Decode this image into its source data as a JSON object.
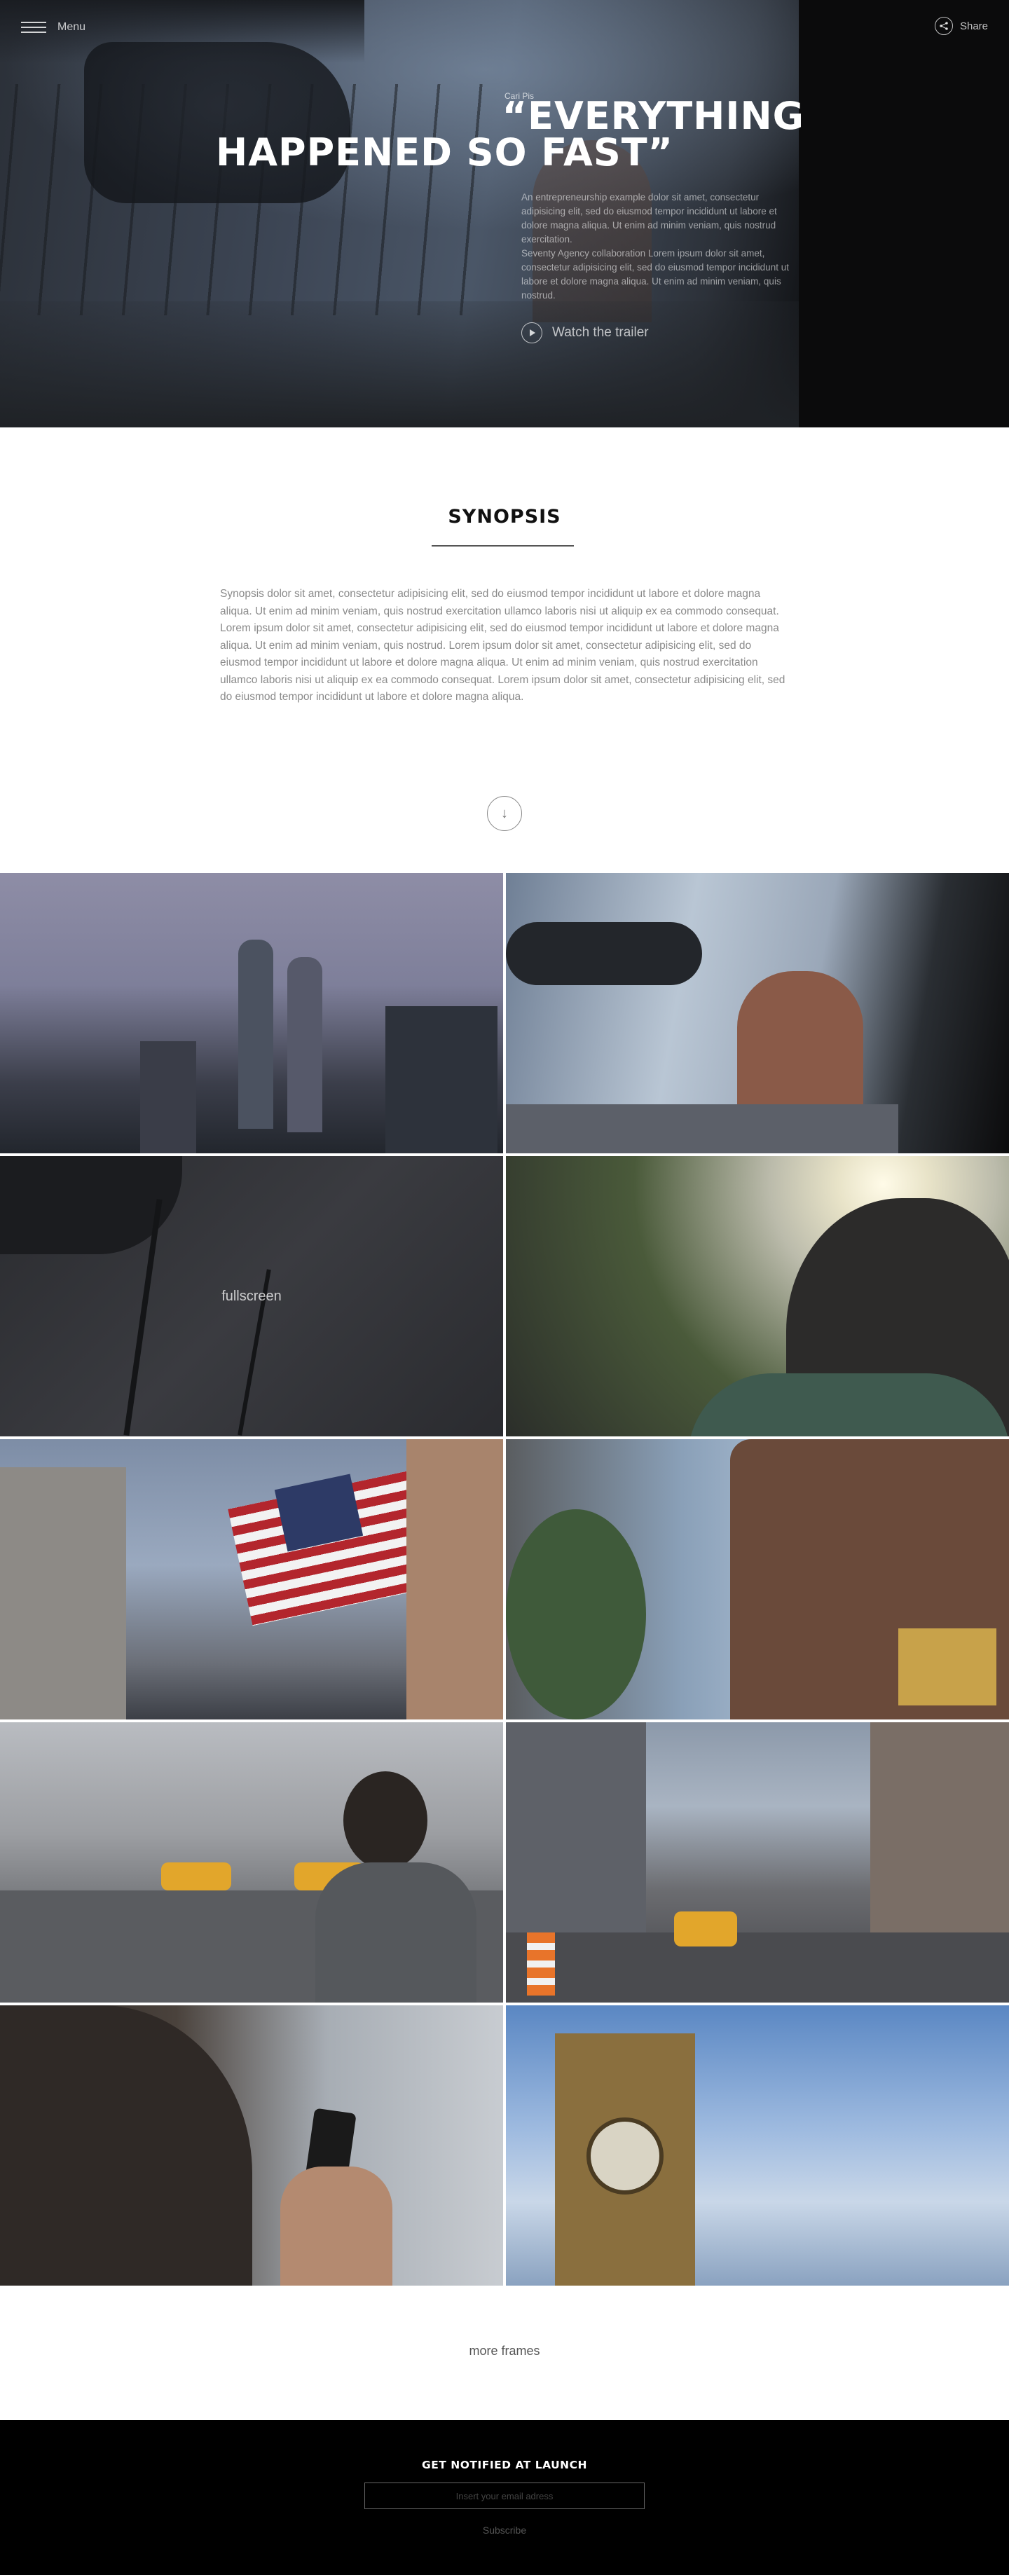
{
  "header": {
    "menu_label": "Menu",
    "share_label": "Share"
  },
  "hero": {
    "quote_author": "Cari Pis",
    "quote_line1": "“EVERYTHING",
    "quote_line2": "HAPPENED SO FAST”",
    "description_1": "An entrepreneurship example dolor sit amet, consectetur adipisicing elit, sed do eiusmod tempor incididunt ut labore et dolore magna aliqua. Ut enim ad minim veniam, quis nostrud exercitation.",
    "description_2": "Seventy Agency collaboration Lorem ipsum dolor sit amet, consectetur adipisicing elit, sed do eiusmod tempor incididunt ut labore et dolore magna aliqua. Ut enim ad minim veniam, quis nostrud.",
    "trailer_label": "Watch the trailer"
  },
  "synopsis": {
    "title": "SYNOPSIS",
    "text": "Synopsis dolor sit amet, consectetur adipisicing elit, sed do eiusmod tempor incididunt ut labore et dolore magna aliqua. Ut enim ad minim veniam, quis nostrud exercitation ullamco laboris nisi ut aliquip ex ea commodo consequat. Lorem ipsum dolor sit amet, consectetur adipisicing elit, sed do eiusmod tempor incididunt ut labore et dolore magna aliqua. Ut enim ad minim veniam, quis nostrud. Lorem ipsum dolor sit amet, consectetur adipisicing elit, sed do eiusmod tempor incididunt ut labore et dolore magna aliqua. Ut enim ad minim veniam, quis nostrud exercitation ullamco laboris nisi ut aliquip ex ea commodo consequat. Lorem ipsum dolor sit amet, consectetur adipisicing elit, sed do eiusmod tempor incididunt ut labore et dolore magna aliqua.",
    "down_arrow": "↓"
  },
  "gallery": {
    "hover_label": "fullscreen",
    "more_label": "more frames"
  },
  "footer": {
    "notify_title": "GET NOTIFIED AT LAUNCH",
    "email_placeholder": "Insert your email adress",
    "subscribe_label": "Subscribe"
  },
  "colors": {
    "footer_bg": "#000000",
    "synopsis_text": "#8a8a8a"
  }
}
